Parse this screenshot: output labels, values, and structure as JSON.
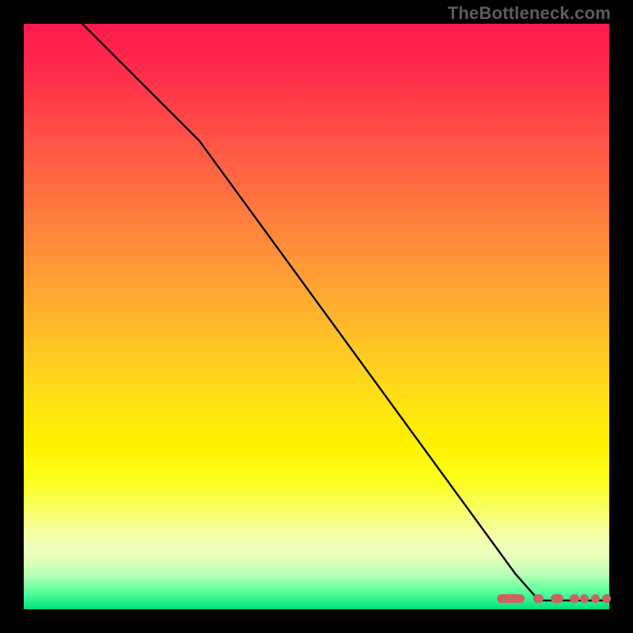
{
  "watermark": "TheBottleneck.com",
  "colors": {
    "marker": "#c96460",
    "curve": "#000000"
  },
  "chart_data": {
    "type": "line",
    "title": "",
    "xlabel": "",
    "ylabel": "",
    "xlim": [
      0,
      100
    ],
    "ylim": [
      0,
      100
    ],
    "series": [
      {
        "name": "bottleneck-curve",
        "x": [
          10,
          30,
          84,
          88,
          100
        ],
        "y": [
          100,
          80,
          6,
          1.5,
          1.5
        ]
      }
    ],
    "markers": {
      "name": "suggested-range",
      "style": "segments_and_dots",
      "segments": [
        {
          "x0": 80.8,
          "x1": 85.5,
          "y": 1.8
        },
        {
          "x0": 87.0,
          "x1": 88.8,
          "y": 1.8
        },
        {
          "x0": 90.0,
          "x1": 92.2,
          "y": 1.8
        },
        {
          "x0": 93.2,
          "x1": 94.8,
          "y": 1.8
        }
      ],
      "dots": [
        {
          "x": 95.8,
          "y": 1.8
        },
        {
          "x": 97.6,
          "y": 1.8
        },
        {
          "x": 99.5,
          "y": 1.8
        }
      ]
    }
  }
}
